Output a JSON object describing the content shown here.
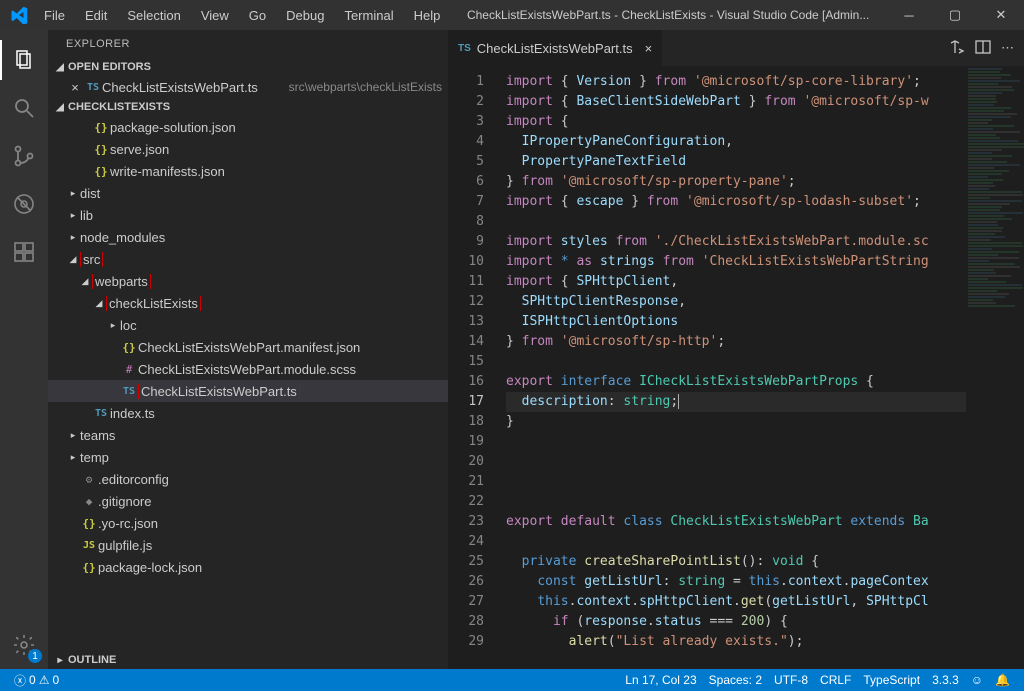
{
  "menu": [
    "File",
    "Edit",
    "Selection",
    "View",
    "Go",
    "Debug",
    "Terminal",
    "Help"
  ],
  "title": "CheckListExistsWebPart.ts - CheckListExists - Visual Studio Code [Admin...",
  "sidebar": {
    "title": "EXPLORER",
    "openEditorsHeader": "OPEN EDITORS",
    "openEditor": {
      "icon": "TS",
      "name": "CheckListExistsWebPart.ts",
      "path": "src\\webparts\\checkListExists"
    },
    "projectHeader": "CHECKLISTEXISTS",
    "tree": [
      {
        "indent": 2,
        "icon": "{}",
        "iconClass": "ic-json",
        "label": "package-solution.json"
      },
      {
        "indent": 2,
        "icon": "{}",
        "iconClass": "ic-json",
        "label": "serve.json"
      },
      {
        "indent": 2,
        "icon": "{}",
        "iconClass": "ic-json",
        "label": "write-manifests.json"
      },
      {
        "indent": 1,
        "chev": "▸",
        "label": "dist"
      },
      {
        "indent": 1,
        "chev": "▸",
        "label": "lib"
      },
      {
        "indent": 1,
        "chev": "▸",
        "label": "node_modules"
      },
      {
        "indent": 1,
        "chev": "◢",
        "label": "src",
        "boxed": true
      },
      {
        "indent": 2,
        "chev": "◢",
        "label": "webparts",
        "boxed": true
      },
      {
        "indent": 3,
        "chev": "◢",
        "label": "checkListExists",
        "boxed": true
      },
      {
        "indent": 4,
        "chev": "▸",
        "label": "loc"
      },
      {
        "indent": 4,
        "icon": "{}",
        "iconClass": "ic-json",
        "label": "CheckListExistsWebPart.manifest.json"
      },
      {
        "indent": 4,
        "icon": "#",
        "iconClass": "ic-scss",
        "label": "CheckListExistsWebPart.module.scss"
      },
      {
        "indent": 4,
        "icon": "TS",
        "iconClass": "ic-ts",
        "label": "CheckListExistsWebPart.ts",
        "boxed": true,
        "selected": true
      },
      {
        "indent": 2,
        "icon": "TS",
        "iconClass": "ic-ts",
        "label": "index.ts"
      },
      {
        "indent": 1,
        "chev": "▸",
        "label": "teams"
      },
      {
        "indent": 1,
        "chev": "▸",
        "label": "temp"
      },
      {
        "indent": 1,
        "icon": "⚙",
        "iconClass": "ic-gear",
        "label": ".editorconfig"
      },
      {
        "indent": 1,
        "icon": "◆",
        "iconClass": "ic-gear",
        "label": ".gitignore"
      },
      {
        "indent": 1,
        "icon": "{}",
        "iconClass": "ic-json",
        "label": ".yo-rc.json"
      },
      {
        "indent": 1,
        "icon": "JS",
        "iconClass": "ic-js",
        "label": "gulpfile.js"
      },
      {
        "indent": 1,
        "icon": "{}",
        "iconClass": "ic-json",
        "label": "package-lock.json"
      }
    ],
    "outlineHeader": "OUTLINE"
  },
  "editor": {
    "tabIcon": "TS",
    "tabName": "CheckListExistsWebPart.ts",
    "lines": [
      [
        {
          "c": "tk-kw",
          "t": "import"
        },
        {
          "t": " { "
        },
        {
          "c": "tk-var",
          "t": "Version"
        },
        {
          "t": " } "
        },
        {
          "c": "tk-kw",
          "t": "from"
        },
        {
          "t": " "
        },
        {
          "c": "tk-str",
          "t": "'@microsoft/sp-core-library'"
        },
        {
          "t": ";"
        }
      ],
      [
        {
          "c": "tk-kw",
          "t": "import"
        },
        {
          "t": " { "
        },
        {
          "c": "tk-var",
          "t": "BaseClientSideWebPart"
        },
        {
          "t": " } "
        },
        {
          "c": "tk-kw",
          "t": "from"
        },
        {
          "t": " "
        },
        {
          "c": "tk-str",
          "t": "'@microsoft/sp-w"
        }
      ],
      [
        {
          "c": "tk-kw",
          "t": "import"
        },
        {
          "t": " {"
        }
      ],
      [
        {
          "t": "  "
        },
        {
          "c": "tk-var",
          "t": "IPropertyPaneConfiguration"
        },
        {
          "t": ","
        }
      ],
      [
        {
          "t": "  "
        },
        {
          "c": "tk-var",
          "t": "PropertyPaneTextField"
        }
      ],
      [
        {
          "t": "} "
        },
        {
          "c": "tk-kw",
          "t": "from"
        },
        {
          "t": " "
        },
        {
          "c": "tk-str",
          "t": "'@microsoft/sp-property-pane'"
        },
        {
          "t": ";"
        }
      ],
      [
        {
          "c": "tk-kw",
          "t": "import"
        },
        {
          "t": " { "
        },
        {
          "c": "tk-var",
          "t": "escape"
        },
        {
          "t": " } "
        },
        {
          "c": "tk-kw",
          "t": "from"
        },
        {
          "t": " "
        },
        {
          "c": "tk-str",
          "t": "'@microsoft/sp-lodash-subset'"
        },
        {
          "t": ";"
        }
      ],
      [],
      [
        {
          "c": "tk-kw",
          "t": "import"
        },
        {
          "t": " "
        },
        {
          "c": "tk-var",
          "t": "styles"
        },
        {
          "t": " "
        },
        {
          "c": "tk-kw",
          "t": "from"
        },
        {
          "t": " "
        },
        {
          "c": "tk-str",
          "t": "'./CheckListExistsWebPart.module.sc"
        }
      ],
      [
        {
          "c": "tk-kw",
          "t": "import"
        },
        {
          "t": " "
        },
        {
          "c": "tk-blue",
          "t": "*"
        },
        {
          "t": " "
        },
        {
          "c": "tk-kw",
          "t": "as"
        },
        {
          "t": " "
        },
        {
          "c": "tk-var",
          "t": "strings"
        },
        {
          "t": " "
        },
        {
          "c": "tk-kw",
          "t": "from"
        },
        {
          "t": " "
        },
        {
          "c": "tk-str",
          "t": "'CheckListExistsWebPartString"
        }
      ],
      [
        {
          "c": "tk-kw",
          "t": "import"
        },
        {
          "t": " { "
        },
        {
          "c": "tk-var",
          "t": "SPHttpClient"
        },
        {
          "t": ","
        }
      ],
      [
        {
          "t": "  "
        },
        {
          "c": "tk-var",
          "t": "SPHttpClientResponse"
        },
        {
          "t": ","
        }
      ],
      [
        {
          "t": "  "
        },
        {
          "c": "tk-var",
          "t": "ISPHttpClientOptions"
        }
      ],
      [
        {
          "t": "} "
        },
        {
          "c": "tk-kw",
          "t": "from"
        },
        {
          "t": " "
        },
        {
          "c": "tk-str",
          "t": "'@microsoft/sp-http'"
        },
        {
          "t": ";"
        }
      ],
      [],
      [
        {
          "c": "tk-kw",
          "t": "export"
        },
        {
          "t": " "
        },
        {
          "c": "tk-blue",
          "t": "interface"
        },
        {
          "t": " "
        },
        {
          "c": "tk-type",
          "t": "ICheckListExistsWebPartProps"
        },
        {
          "t": " {"
        }
      ],
      [
        {
          "t": "  "
        },
        {
          "c": "tk-var",
          "t": "description"
        },
        {
          "t": ": "
        },
        {
          "c": "tk-type",
          "t": "string"
        },
        {
          "t": ";"
        }
      ],
      [
        {
          "t": "}"
        }
      ],
      [],
      [],
      [],
      [],
      [
        {
          "c": "tk-kw",
          "t": "export"
        },
        {
          "t": " "
        },
        {
          "c": "tk-kw",
          "t": "default"
        },
        {
          "t": " "
        },
        {
          "c": "tk-blue",
          "t": "class"
        },
        {
          "t": " "
        },
        {
          "c": "tk-type",
          "t": "CheckListExistsWebPart"
        },
        {
          "t": " "
        },
        {
          "c": "tk-blue",
          "t": "extends"
        },
        {
          "t": " "
        },
        {
          "c": "tk-type",
          "t": "Ba"
        }
      ],
      [],
      [
        {
          "t": "  "
        },
        {
          "c": "tk-blue",
          "t": "private"
        },
        {
          "t": " "
        },
        {
          "c": "tk-fn",
          "t": "createSharePointList"
        },
        {
          "t": "(): "
        },
        {
          "c": "tk-type",
          "t": "void"
        },
        {
          "t": " {"
        }
      ],
      [
        {
          "t": "    "
        },
        {
          "c": "tk-blue",
          "t": "const"
        },
        {
          "t": " "
        },
        {
          "c": "tk-var",
          "t": "getListUrl"
        },
        {
          "t": ": "
        },
        {
          "c": "tk-type",
          "t": "string"
        },
        {
          "t": " = "
        },
        {
          "c": "tk-blue",
          "t": "this"
        },
        {
          "t": "."
        },
        {
          "c": "tk-var",
          "t": "context"
        },
        {
          "t": "."
        },
        {
          "c": "tk-var",
          "t": "pageContex"
        }
      ],
      [
        {
          "t": "    "
        },
        {
          "c": "tk-blue",
          "t": "this"
        },
        {
          "t": "."
        },
        {
          "c": "tk-var",
          "t": "context"
        },
        {
          "t": "."
        },
        {
          "c": "tk-var",
          "t": "spHttpClient"
        },
        {
          "t": "."
        },
        {
          "c": "tk-fn",
          "t": "get"
        },
        {
          "t": "("
        },
        {
          "c": "tk-var",
          "t": "getListUrl"
        },
        {
          "t": ", "
        },
        {
          "c": "tk-var",
          "t": "SPHttpCl"
        }
      ],
      [
        {
          "t": "      "
        },
        {
          "c": "tk-kw",
          "t": "if"
        },
        {
          "t": " ("
        },
        {
          "c": "tk-var",
          "t": "response"
        },
        {
          "t": "."
        },
        {
          "c": "tk-var",
          "t": "status"
        },
        {
          "t": " === "
        },
        {
          "c": "tk-num",
          "t": "200"
        },
        {
          "t": ") {"
        }
      ],
      [
        {
          "t": "        "
        },
        {
          "c": "tk-fn",
          "t": "alert"
        },
        {
          "t": "("
        },
        {
          "c": "tk-str",
          "t": "\"List already exists.\""
        },
        {
          "t": ");"
        }
      ]
    ]
  },
  "status": {
    "errors": "0",
    "warnings": "0",
    "position": "Ln 17, Col 23",
    "spaces": "Spaces: 2",
    "encoding": "UTF-8",
    "eol": "CRLF",
    "lang": "TypeScript",
    "version": "3.3.3"
  },
  "settingsBadge": "1"
}
